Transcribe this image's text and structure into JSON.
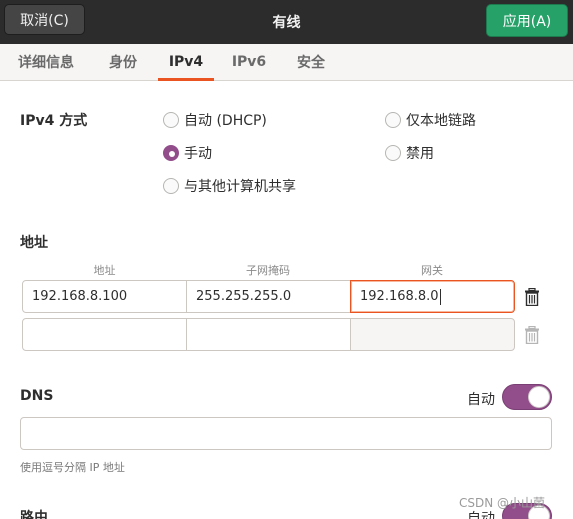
{
  "titlebar": {
    "cancel_label": "取消(C)",
    "title": "有线",
    "apply_label": "应用(A)"
  },
  "tabs": [
    {
      "label": "详细信息",
      "active": false
    },
    {
      "label": "身份",
      "active": false
    },
    {
      "label": "IPv4",
      "active": true
    },
    {
      "label": "IPv6",
      "active": false
    },
    {
      "label": "安全",
      "active": false
    }
  ],
  "ipv4_method": {
    "label": "IPv4 方式",
    "options": [
      {
        "label": "自动 (DHCP)",
        "checked": false
      },
      {
        "label": "仅本地链路",
        "checked": false
      },
      {
        "label": "手动",
        "checked": true
      },
      {
        "label": "禁用",
        "checked": false
      },
      {
        "label": "与其他计算机共享",
        "checked": false
      }
    ]
  },
  "addresses": {
    "label": "地址",
    "columns": [
      "地址",
      "子网掩码",
      "网关"
    ],
    "rows": [
      {
        "address": "192.168.8.100",
        "netmask": "255.255.255.0",
        "gateway": "192.168.8.0"
      },
      {
        "address": "",
        "netmask": "",
        "gateway": ""
      }
    ],
    "delete_icon": "trash-icon"
  },
  "dns": {
    "label": "DNS",
    "auto_label": "自动",
    "auto_enabled": true,
    "value": "",
    "hint": "使用逗号分隔 IP 地址"
  },
  "routes": {
    "label": "路由",
    "auto_label": "自动",
    "auto_enabled": true
  },
  "watermark": "CSDN @小山菌",
  "colors": {
    "accent": "#e95420",
    "toggle_on": "#924d8b",
    "apply_button": "#26a269",
    "titlebar": "#2c2c2c"
  }
}
